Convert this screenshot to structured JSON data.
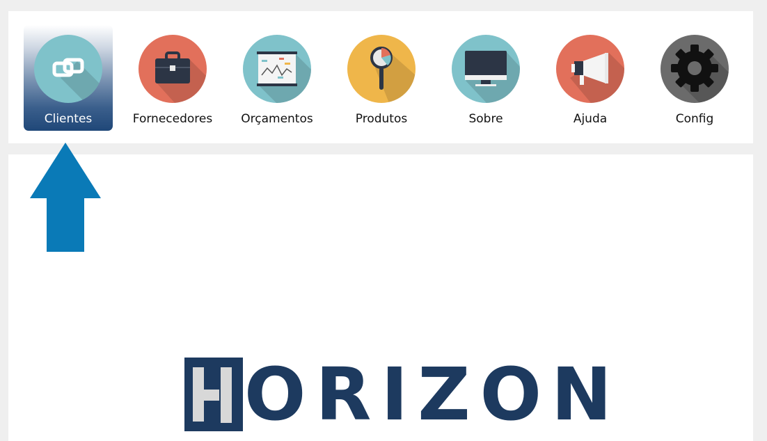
{
  "toolbar": {
    "items": [
      {
        "label": "Clientes",
        "icon": "link-chain-icon",
        "color": "#7fc2ca",
        "active": true
      },
      {
        "label": "Fornecedores",
        "icon": "briefcase-icon",
        "color": "#e2705b",
        "active": false
      },
      {
        "label": "Orçamentos",
        "icon": "presentation-chart-icon",
        "color": "#7fc2ca",
        "active": false
      },
      {
        "label": "Produtos",
        "icon": "magnifier-icon",
        "color": "#efb64a",
        "active": false
      },
      {
        "label": "Sobre",
        "icon": "monitor-icon",
        "color": "#7fc2ca",
        "active": false
      },
      {
        "label": "Ajuda",
        "icon": "megaphone-icon",
        "color": "#e2705b",
        "active": false
      },
      {
        "label": "Config",
        "icon": "gear-icon",
        "color": "#6b6b6b",
        "active": false
      }
    ]
  },
  "brand": {
    "logo_letter": "H",
    "logo_rest": "ORIZON",
    "color": "#1d3a5f"
  },
  "pointer": {
    "icon": "up-arrow-icon",
    "color": "#0a7ab7"
  }
}
